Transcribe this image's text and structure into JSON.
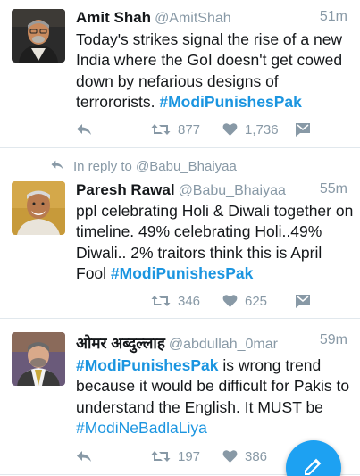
{
  "tweets": [
    {
      "name": "Amit Shah",
      "handle": "@AmitShah",
      "time": "51m",
      "text_before": "Today's strikes signal the rise of a new India where the GoI doesn't get cowed down by nefarious designs of terrororists. ",
      "hashtag": "#ModiPunishesPak",
      "retweets": "877",
      "likes": "1,736"
    },
    {
      "reply_to": "In reply to @Babu_Bhaiyaa",
      "name": "Paresh Rawal",
      "handle": "@Babu_Bhaiyaa",
      "time": "55m",
      "text_before": "ppl celebrating Holi & Diwali together on timeline. 49% celebrating Holi..49% Diwali.. 2% traitors think this is April Fool ",
      "hashtag": "#ModiPunishesPak",
      "retweets": "346",
      "likes": "625"
    },
    {
      "name": "ओमर अब्दुल्लाह",
      "handle": "@abdullah_0mar",
      "time": "59m",
      "hashtag": "#ModiPunishesPak",
      "text_after": " is wrong trend because it would be difficult for Pakis to understand the English. It MUST be ",
      "hashtag2": "#ModiNeBadlaLiya",
      "retweets": "197",
      "likes": "386"
    }
  ],
  "icons": {
    "reply": "reply-icon",
    "retweet": "retweet-icon",
    "like": "heart-icon",
    "dm": "direct-message-icon",
    "compose": "compose-tweet-icon"
  },
  "colors": {
    "link": "#1b95e0",
    "muted": "#8899a6",
    "fab": "#1da1f2"
  }
}
